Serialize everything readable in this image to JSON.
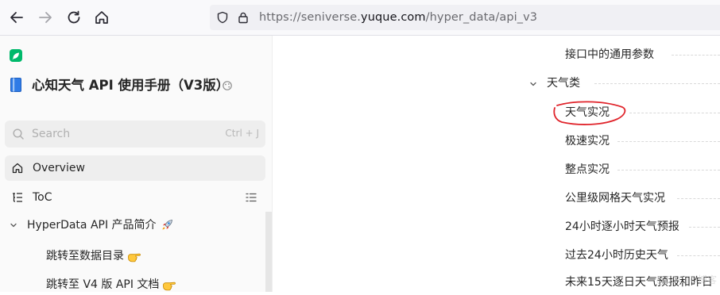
{
  "browser": {
    "url_prefix": "https://seniverse.",
    "url_host": "yuque.com",
    "url_path": "/hyper_data/api_v3"
  },
  "sidebar": {
    "book_title": "心知天气 API 使用手册（V3版）",
    "search": {
      "placeholder": "Search",
      "shortcut": "Ctrl + J"
    },
    "overview_label": "Overview",
    "toc_label": "ToC",
    "tree": {
      "section_label": "HyperData API 产品简介",
      "items": [
        {
          "label": "跳转至数据目录"
        },
        {
          "label": "跳转至 V4 版 API 文档"
        }
      ]
    }
  },
  "toc": {
    "items": [
      {
        "label": "接口中的通用参数"
      },
      {
        "label": "天气类"
      },
      {
        "label": "天气实况"
      },
      {
        "label": "极速实况"
      },
      {
        "label": "整点实况"
      },
      {
        "label": "公里级网格天气实况"
      },
      {
        "label": "24小时逐小时天气预报"
      },
      {
        "label": "过去24小时历史天气"
      },
      {
        "label": "未来15天逐日天气预报和昨日"
      }
    ]
  },
  "watermark": "@51CTO博客",
  "colors": {
    "brand_green": "#00b96b",
    "annotation_red": "#e0242b",
    "active_row_bg": "#eeeeee"
  },
  "icons": {
    "back": "arrow-left",
    "forward": "arrow-right",
    "reload": "circular-arrow",
    "home": "house",
    "shield": "tracking-protection-shield",
    "lock": "padlock",
    "book": "blue-book",
    "overview": "house-outline",
    "toc": "list-tree",
    "rocket": "rocket-emoji",
    "hand": "pointing-hand-emoji"
  }
}
